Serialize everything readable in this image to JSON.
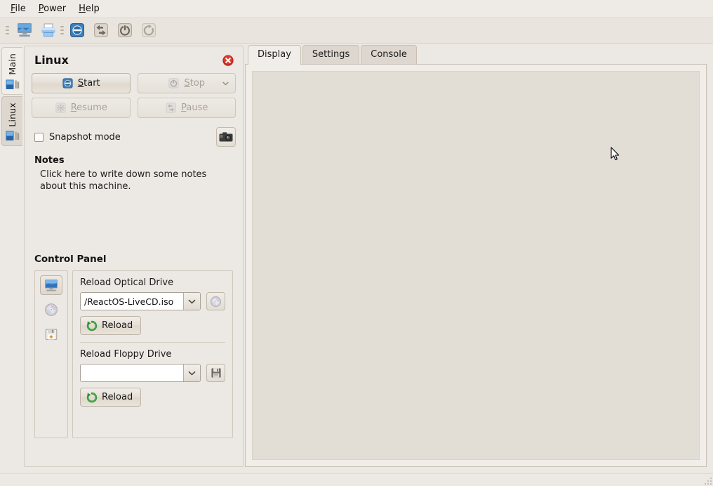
{
  "window": {
    "title": "Linux"
  },
  "menubar": {
    "items": [
      {
        "label": "File",
        "mnemonic": "F"
      },
      {
        "label": "Power",
        "mnemonic": "P"
      },
      {
        "label": "Help",
        "mnemonic": "H"
      }
    ]
  },
  "toolbar": {
    "buttons": [
      {
        "name": "new-vm-icon",
        "tooltip": "New VM"
      },
      {
        "name": "print-icon",
        "tooltip": "Print"
      },
      {
        "name": "start-vm-icon",
        "tooltip": "Start"
      },
      {
        "name": "pause-vm-icon",
        "tooltip": "Pause"
      },
      {
        "name": "power-off-icon",
        "tooltip": "Power Off"
      },
      {
        "name": "reset-vm-icon",
        "tooltip": "Reset"
      }
    ]
  },
  "rail": {
    "tabs": [
      {
        "label": "Main",
        "active": true
      },
      {
        "label": "Linux",
        "active": false
      }
    ]
  },
  "left_panel": {
    "title": "Linux",
    "close_label": "×",
    "buttons": {
      "start": {
        "label": "Start",
        "mnemonic": "S",
        "enabled": true
      },
      "stop": {
        "label": "Stop",
        "mnemonic": "S",
        "enabled": false,
        "has_menu": true
      },
      "resume": {
        "label": "Resume",
        "mnemonic": "R",
        "enabled": false
      },
      "pause": {
        "label": "Pause",
        "mnemonic": "P",
        "enabled": false
      }
    },
    "snapshot": {
      "label": "Snapshot mode",
      "checked": false,
      "camera_button": "take-screenshot-button"
    },
    "notes": {
      "heading": "Notes",
      "placeholder": "Click here to write down some notes about this machine."
    },
    "control_panel": {
      "heading": "Control Panel",
      "device_tabs": [
        {
          "name": "display-device",
          "selected": true
        },
        {
          "name": "optical-device",
          "selected": false
        },
        {
          "name": "floppy-device",
          "selected": false
        }
      ],
      "optical": {
        "label": "Reload Optical Drive",
        "value": "/ReactOS-LiveCD.iso",
        "placeholder": "",
        "browse_icon": "cdrom-icon",
        "reload_label": "Reload"
      },
      "floppy": {
        "label": "Reload Floppy Drive",
        "value": "",
        "placeholder": "",
        "browse_icon": "floppy-icon",
        "reload_label": "Reload"
      }
    }
  },
  "right_panel": {
    "tabs": [
      {
        "label": "Display",
        "active": true
      },
      {
        "label": "Settings",
        "active": false
      },
      {
        "label": "Console",
        "active": false
      }
    ],
    "display": {
      "content": ""
    }
  },
  "colors": {
    "window_bg": "#ece8e3",
    "panel_bg": "#f1eee9",
    "display_bg": "#e2ddd5",
    "border": "#c8c0b4",
    "text": "#1b1b1b",
    "accent_blue": "#2f6fa8",
    "accent_green": "#2f9b2f",
    "close_red": "#cc2b20"
  }
}
